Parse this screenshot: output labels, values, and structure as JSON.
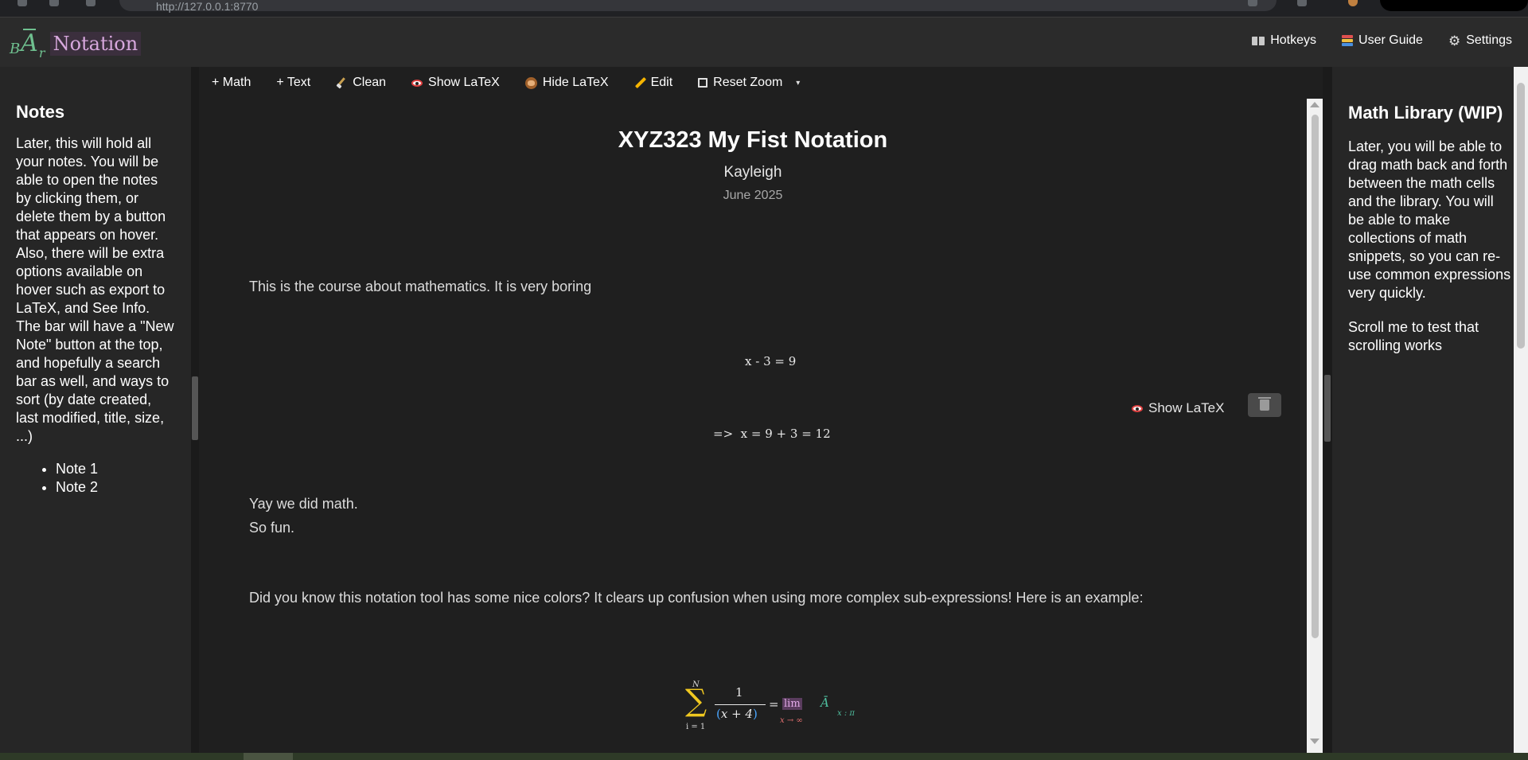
{
  "browser": {
    "url": "http://127.0.0.1:8770"
  },
  "header": {
    "logo": {
      "b": "B",
      "a": "A",
      "r": "r",
      "word": "Notation"
    },
    "nav": [
      {
        "label": "Hotkeys",
        "icon": "book-icon"
      },
      {
        "label": "User Guide",
        "icon": "books-icon"
      },
      {
        "label": "Settings",
        "icon": "gear-icon"
      }
    ]
  },
  "left_sidebar": {
    "title": "Notes",
    "description": "Later, this will hold all your notes. You will be able to open the notes by clicking them, or delete them by a button that appears on hover. Also, there will be extra options available on hover such as export to LaTeX, and See Info. The bar will have a \"New Note\" button at the top, and hopefully a search bar as well, and ways to sort (by date created, last modified, title, size, ...)",
    "notes": [
      "Note 1",
      "Note 2"
    ]
  },
  "toolbar": {
    "math": "+ Math",
    "text": "+ Text",
    "clean": "Clean",
    "show_latex": "Show LaTeX",
    "hide_latex": "Hide LaTeX",
    "edit": "Edit",
    "reset_zoom": "Reset Zoom",
    "more": "▾"
  },
  "document": {
    "title": "XYZ323 My Fist Notation",
    "author": "Kayleigh",
    "date": "June 2025",
    "intro": "This is the course about mathematics. It is very boring",
    "math1": "x - 3 = 9",
    "math2": "=>  x = 9 + 3 = 12",
    "cell_show_latex": "Show LaTeX",
    "after1": "Yay we did math.",
    "after2": "So fun.",
    "colors_text": "Did you know this notation tool has some nice colors? It clears up confusion when using more complex sub-expressions! Here is an example:",
    "formula": {
      "sum_top": "N",
      "sum_bottom": "i = 1",
      "numerator": "1",
      "denominator": "x + 4",
      "equals": "=",
      "lim": "lim",
      "lim_sub": "x → ∞",
      "a_bar": "Ā",
      "sub": "x : π"
    }
  },
  "right_sidebar": {
    "title": "Math Library (WIP)",
    "description": "Later, you will be able to drag math back and forth between the math cells and the library. You will be able to make collections of math snippets, so you can re-use common expressions very quickly.",
    "scroll_text": "Scroll me to test that scrolling works"
  },
  "colors": {
    "accent_green": "#6fc08f",
    "accent_pink": "#d7a8dd",
    "sum_yellow": "#f0c820",
    "paren_blue": "#4aa6ff",
    "lim_purple": "#e0a8e6",
    "sub_teal": "#4fbf9f"
  }
}
